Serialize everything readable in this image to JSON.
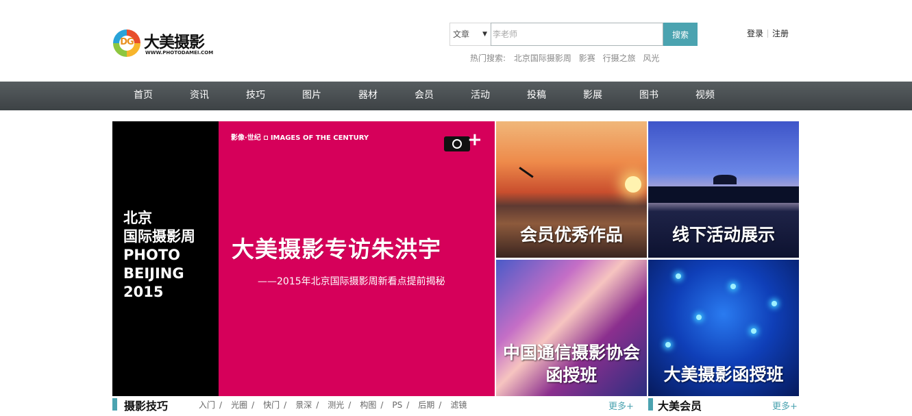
{
  "logo": {
    "mark": "DG",
    "title": "大美摄影",
    "subtitle": "WWW.PHOTODAMEI.COM"
  },
  "search": {
    "category": "文章",
    "placeholder": "李老师",
    "button": "搜索",
    "hot_label": "热门搜索:",
    "hot_terms": [
      "北京国际摄影周",
      "影赛",
      "行摄之旅",
      "风光"
    ]
  },
  "user": {
    "login": "登录",
    "register": "注册"
  },
  "nav": [
    "首页",
    "资讯",
    "技巧",
    "图片",
    "器材",
    "会员",
    "活动",
    "投稿",
    "影展",
    "图书",
    "视频"
  ],
  "banner": {
    "side_lines": [
      "北京",
      "国际摄影周",
      "PHOTO",
      "BEIJING",
      "2015"
    ],
    "tag_left": "影像·世纪",
    "tag_right": "IMAGES OF THE CENTURY",
    "plus": "+",
    "title": "大美摄影专访朱洪宇",
    "subtitle": "——2015年北京国际摄影周新看点提前揭秘"
  },
  "tiles": [
    {
      "label_lines": [
        "会员优秀作品"
      ]
    },
    {
      "label_lines": [
        "线下活动展示"
      ]
    },
    {
      "label_lines": [
        "中国通信摄影协会",
        "函授班"
      ]
    },
    {
      "label_lines": [
        "大美摄影函授班"
      ]
    }
  ],
  "section_tips": {
    "title": "摄影技巧",
    "tags": [
      "入门",
      "光圈",
      "快门",
      "景深",
      "测光",
      "构图",
      "PS",
      "后期",
      "滤镜"
    ],
    "more": "更多+"
  },
  "section_members": {
    "title": "大美会员",
    "more": "更多+"
  },
  "colors": {
    "accent": "#4ba3b0",
    "nav_bg": "#484d50",
    "banner_bg": "#d6005a"
  }
}
